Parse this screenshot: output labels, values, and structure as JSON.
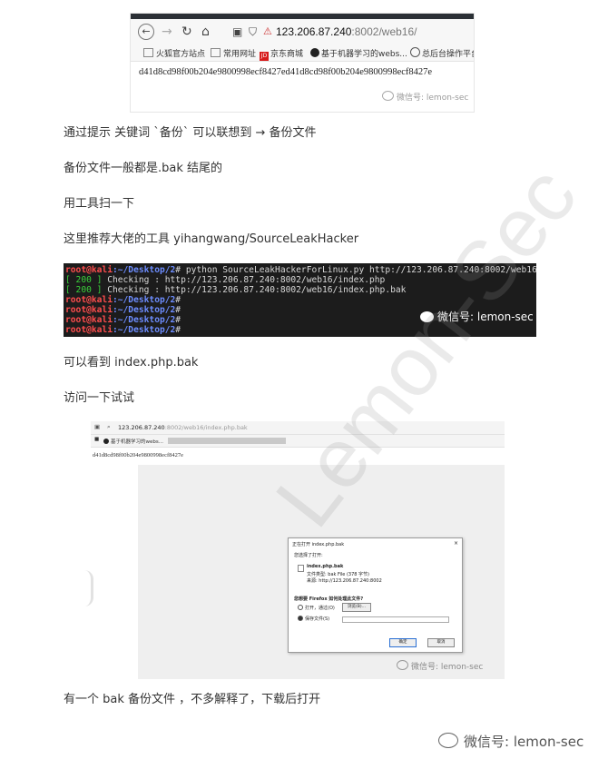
{
  "screenshot1": {
    "url_host": "123.206.87.240",
    "url_rest": ":8002/web16/",
    "bookmarks": [
      "火狐官方站点",
      "常用网址",
      "京东商城",
      "基于机器学习的webs...",
      "总后台操作平台"
    ],
    "jd_badge": "JD",
    "hash": "d41d8cd98f00b204e9800998ecf8427ed41d8cd98f00b204e9800998ecf8427e",
    "watermark": "微信号: lemon-sec"
  },
  "lines": {
    "l1": "通过提示  关键词 `备份` 可以联想到  →    备份文件",
    "l2": "备份文件一般都是.bak 结尾的",
    "l3": "用工具扫一下",
    "l4": "这里推荐大佬的工具    yihangwang/SourceLeakHacker",
    "l5": "可以看到 index.php.bak",
    "l6": "访问一下试试",
    "l7": "有一个 bak 备份文件  ，不多解释了，下载后打开"
  },
  "terminal": {
    "prompt_user": "root@kali",
    "prompt_path": ":~/Desktop/2",
    "prompt_hash": "#",
    "command": " python SourceLeakHackerForLinux.py http://123.206.87.240:8002/web16",
    "status_code": "[ 200 ]",
    "result1": " Checking : http://123.206.87.240:8002/web16/index.php",
    "result2": " Checking : http://123.206.87.240:8002/web16/index.php.bak",
    "watermark": "微信号: lemon-sec"
  },
  "screenshot2": {
    "url_host": "123.206.87.240",
    "url_rest": ":8002/web16/index.php.bak",
    "bookmark": "基于机器学习的webs...",
    "hash": "d41d8cd98f00b204e9800998ecf8427e",
    "dialog": {
      "title": "正在打开 index.php.bak",
      "close": "×",
      "heading": "您选择了打开:",
      "filename": "index.php.bak",
      "filetype": "文件类型:  bak File (378 字节)",
      "source": "来源:  http://123.206.87.240:8002",
      "question": "您想要 Firefox 如何处理此文件?",
      "open_with": "打开，通过(O)",
      "browse": "浏览(B)...",
      "save": "保存文件(S)",
      "ok": "确定",
      "cancel": "取消"
    },
    "watermark": "微信号: lemon-sec"
  },
  "watermarks": {
    "diagonal": "Lemon-Sec",
    "footer": "微信号: lemon-sec"
  }
}
